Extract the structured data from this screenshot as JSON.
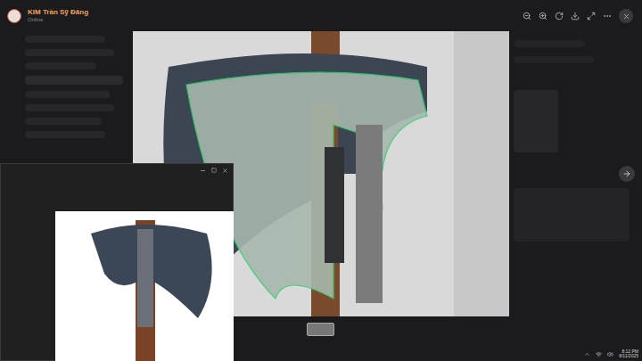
{
  "header": {
    "name": "KIM Trần Sỹ Đăng",
    "status": "Online"
  },
  "taskbar": {
    "time": "8:12 PM",
    "date": "8/11/2025"
  }
}
